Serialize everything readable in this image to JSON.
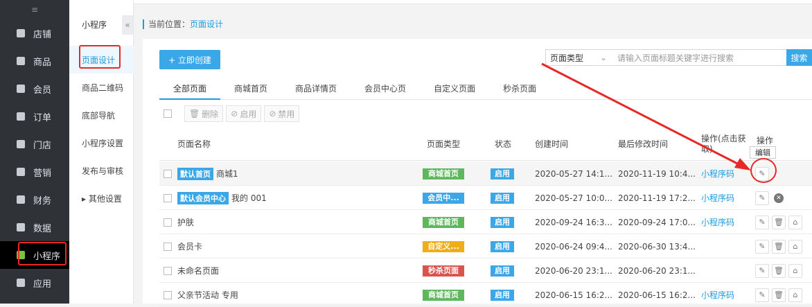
{
  "sidebar": {
    "toggle": "≡",
    "items": [
      {
        "label": "店铺"
      },
      {
        "label": "商品"
      },
      {
        "label": "会员"
      },
      {
        "label": "订单"
      },
      {
        "label": "门店"
      },
      {
        "label": "营销"
      },
      {
        "label": "财务"
      },
      {
        "label": "数据"
      },
      {
        "label": "小程序"
      },
      {
        "label": "应用"
      }
    ]
  },
  "subnav": {
    "title": "小程序",
    "collapse": "«",
    "items": [
      {
        "label": "页面设计"
      },
      {
        "label": "商品二维码"
      },
      {
        "label": "底部导航"
      },
      {
        "label": "小程序设置"
      },
      {
        "label": "发布与审核"
      },
      {
        "label": "▸ 其他设置"
      }
    ]
  },
  "breadcrumb": {
    "prefix": "当前位置：",
    "current": "页面设计"
  },
  "toolbar": {
    "create_label": "+ 立即创建",
    "type_select": "页面类型",
    "search_placeholder": "请输入页面标题关键字进行搜索",
    "search_label": "搜索"
  },
  "tabs": [
    "全部页面",
    "商城首页",
    "商品详情页",
    "会员中心页",
    "自定义页面",
    "秒杀页面"
  ],
  "bulk": {
    "delete": "删除",
    "enable": "启用",
    "disable": "禁用"
  },
  "table": {
    "headers": {
      "name": "页面名称",
      "type": "页面类型",
      "status": "状态",
      "created": "创建时间",
      "modified": "最后修改时间",
      "op_click": "操作(点击获取)",
      "op": "操作"
    },
    "rows": [
      {
        "tag": "默认首页",
        "name": "商城1",
        "type": "商城首页",
        "type_color": "#5cb85c",
        "status": "启用",
        "created": "2020-05-27 14:1...",
        "modified": "2020-11-19 10:4...",
        "qrcode": "小程序码"
      },
      {
        "tag": "默认会员中心",
        "name": "我的 001",
        "type": "会员中...",
        "type_color": "#3aa7e8",
        "status": "启用",
        "created": "2020-05-27 10:0...",
        "modified": "2020-11-19 17:2...",
        "qrcode": "小程序码"
      },
      {
        "tag": "",
        "name": "护肤",
        "type": "商城首页",
        "type_color": "#5cb85c",
        "status": "启用",
        "created": "2020-09-24 16:3...",
        "modified": "2020-09-24 17:0...",
        "qrcode": "小程序码"
      },
      {
        "tag": "",
        "name": "会员卡",
        "type": "自定义...",
        "type_color": "#f0ad1a",
        "status": "启用",
        "created": "2020-06-24 09:4...",
        "modified": "2020-06-30 13:4...",
        "qrcode": ""
      },
      {
        "tag": "",
        "name": "未命名页面",
        "type": "秒杀页面",
        "type_color": "#d9534f",
        "status": "启用",
        "created": "2020-06-20 23:1...",
        "modified": "2020-06-20 23:1...",
        "qrcode": ""
      },
      {
        "tag": "",
        "name": "父亲节活动 专用",
        "type": "商城首页",
        "type_color": "#5cb85c",
        "status": "启用",
        "created": "2020-06-15 16:2...",
        "modified": "2020-06-15 16:2...",
        "qrcode": "小程序码"
      }
    ]
  },
  "tooltip": "编辑"
}
